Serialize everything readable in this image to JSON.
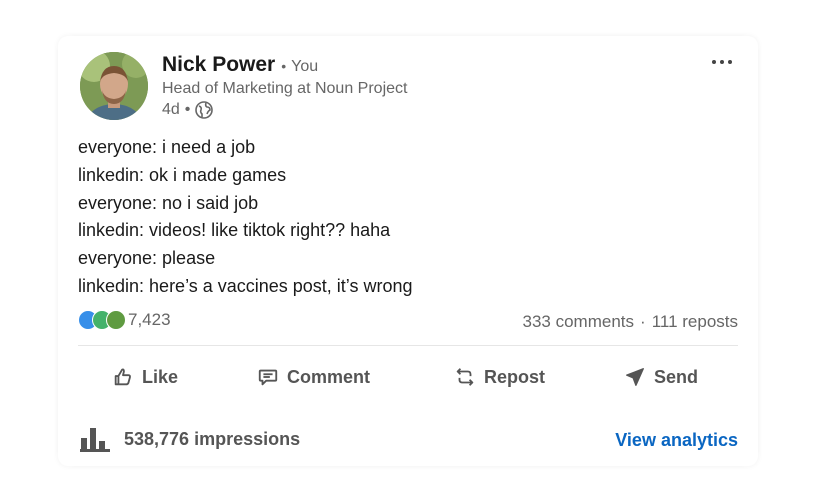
{
  "author": {
    "name": "Nick Power",
    "relation": "You",
    "headline": "Head of Marketing at Noun Project",
    "time": "4d"
  },
  "post": {
    "lines": [
      "everyone: i need a job",
      "linkedin: ok i made games",
      "everyone: no i said job",
      "linkedin: videos! like tiktok right?? haha",
      "everyone: please",
      "linkedin: here’s a vaccines post, it’s wrong"
    ]
  },
  "social": {
    "reaction_count": "7,423",
    "comments": "333 comments",
    "reposts": "111 reposts"
  },
  "actions": {
    "like": "Like",
    "comment": "Comment",
    "repost": "Repost",
    "send": "Send"
  },
  "footer": {
    "impressions": "538,776 impressions",
    "analytics": "View analytics"
  },
  "icons": [
    "globe-icon",
    "more-options-icon",
    "like-icon",
    "comment-icon",
    "repost-icon",
    "send-icon",
    "bar-chart-icon"
  ],
  "colors": {
    "link": "#0a66c2",
    "text_secondary": "#666666"
  }
}
